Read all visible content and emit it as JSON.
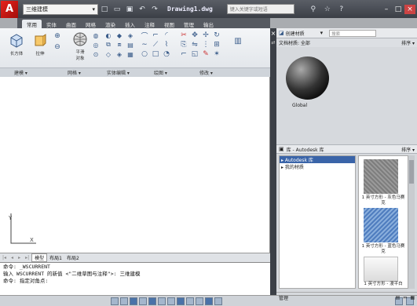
{
  "app": {
    "logo_letter": "A",
    "workspace": "三维建模",
    "doc_title": "Drawing1.dwg",
    "search_placeholder": "键入关键字或短语"
  },
  "ribbon": {
    "tabs": [
      "常用",
      "实体",
      "曲面",
      "网格",
      "渲染",
      "插入",
      "注释",
      "视图",
      "管理",
      "输出"
    ],
    "buttons": [
      {
        "label": "长方体"
      },
      {
        "label": "拉伸"
      },
      {
        "label": "平滑\n对象"
      }
    ],
    "groups": [
      "建模 ▾",
      "网格 ▾",
      "实体编辑 ▾",
      "绘图 ▾",
      "修改 ▾"
    ]
  },
  "layout_tabs": [
    "模型",
    "布局1",
    "布局2"
  ],
  "command_lines": [
    "命令: _WSCURRENT",
    "输入 WSCURRENT 的新值 <\"二维草图与注释\">: 三维建模",
    "命令: 指定对角点:"
  ],
  "palette": {
    "header_title": "创建材质",
    "search_placeholder": "搜索",
    "tab_label": "文档材质: 全部",
    "sort_label": "排序 ▾",
    "preview_label": "Global",
    "library_title": "库 - Autodesk 库",
    "library_sort": "排序 ▾",
    "tree": [
      {
        "label": "▸ Autodesk 库",
        "selected": true
      },
      {
        "label": "▸ 我的材质",
        "selected": false
      }
    ],
    "thumbs": [
      {
        "label": "1 英寸方形 - 灰色马赛克",
        "color": "#7d7d7d"
      },
      {
        "label": "1 英寸方形 - 蓝色马赛克",
        "color": "#4f7dbf"
      },
      {
        "label": "1 英寸方形 - 漫平白",
        "color": "#eeeeee"
      }
    ],
    "footer_label": "管理"
  },
  "colors": {
    "title_bar": "#3b3f46",
    "ribbon_bg": "#e9ecf0",
    "drawing_bg": "#ffffff",
    "selection": "#3a64a8"
  }
}
